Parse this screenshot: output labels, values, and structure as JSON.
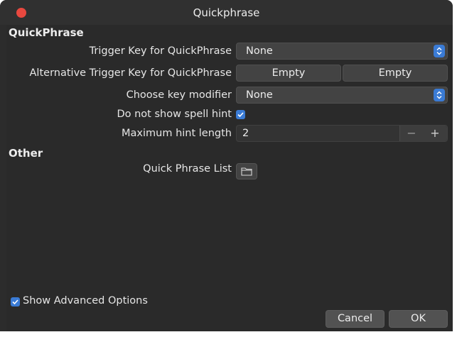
{
  "window": {
    "title": "Quickphrase"
  },
  "sections": {
    "quickphrase": "QuickPhrase",
    "other": "Other"
  },
  "fields": {
    "trigger_key": {
      "label": "Trigger Key for QuickPhrase",
      "value": "None"
    },
    "alt_trigger_key": {
      "label": "Alternative Trigger Key for QuickPhrase",
      "button1": "Empty",
      "button2": "Empty"
    },
    "key_modifier": {
      "label": "Choose key modifier",
      "value": "None"
    },
    "spell_hint": {
      "label": "Do not show spell hint",
      "checked": true
    },
    "max_hint_length": {
      "label": "Maximum hint length",
      "value": "2",
      "minus": "−",
      "plus": "+"
    },
    "phrase_list": {
      "label": "Quick Phrase List",
      "icon": "folder-icon"
    }
  },
  "footer": {
    "advanced_label": "Show Advanced Options",
    "advanced_checked": true,
    "cancel": "Cancel",
    "ok": "OK"
  },
  "colors": {
    "accent": "#3a7bd5",
    "close": "#e8483f",
    "background": "#2a2a2a"
  }
}
